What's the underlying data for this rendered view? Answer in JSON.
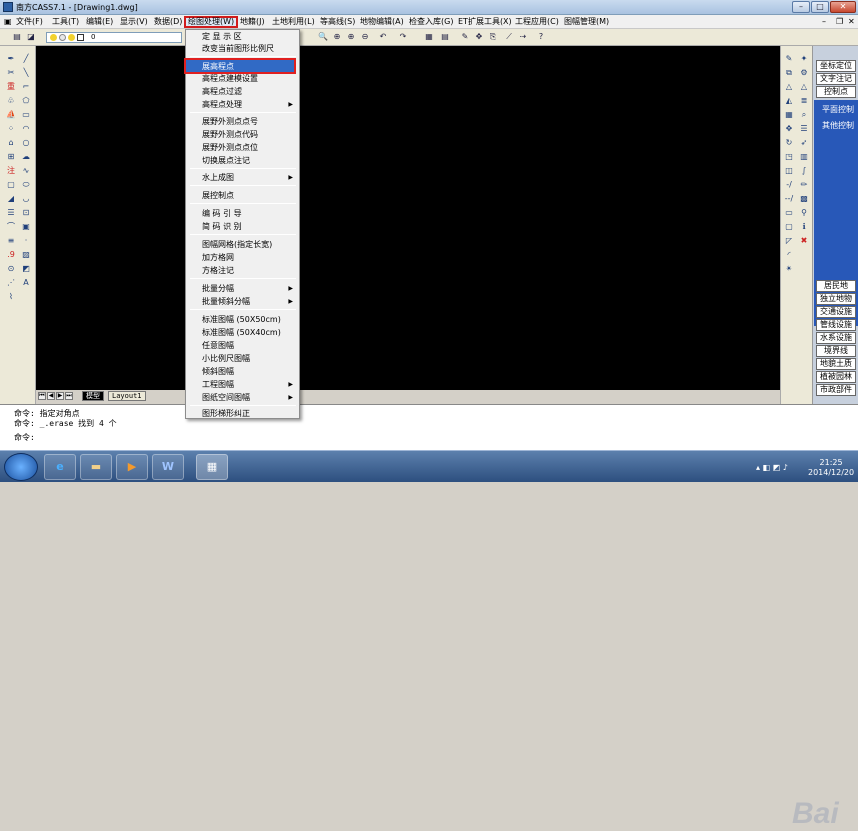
{
  "window": {
    "title": "南方CASS7.1 - [Drawing1.dwg]"
  },
  "menubar": [
    "文件(F)",
    "工具(T)",
    "编辑(E)",
    "显示(V)",
    "数据(D)",
    "绘图处理(W)",
    "地籍(J)",
    "土地利用(L)",
    "等高线(S)",
    "地物编辑(A)",
    "检查入库(G)",
    "ET扩展工具(X)",
    "工程应用(C)",
    "图幅管理(M)"
  ],
  "toolbar": {
    "layer_value": "0"
  },
  "dropdown": {
    "items": [
      "定 显 示 区",
      "改变当前图形比例尺",
      "展高程点",
      "高程点建模设置",
      "高程点过滤",
      "高程点处理",
      "展野外测点点号",
      "展野外测点代码",
      "展野外测点点位",
      "切换展点注记",
      "水上成图",
      "展控制点",
      "编 码 引 导",
      "简 码 识 别",
      "图幅网格(指定长宽)",
      "加方格网",
      "方格注记",
      "批量分幅",
      "批量倾斜分幅",
      "标准图幅 (50X50cm)",
      "标准图幅 (50X40cm)",
      "任意图幅",
      "小比例尺图幅",
      "倾斜图幅",
      "工程图幅",
      "图纸空间图幅",
      "图形梯形纠正"
    ],
    "submenu_indices": [
      5,
      10,
      17,
      18,
      24,
      25
    ],
    "selected": "展高程点"
  },
  "tabs": {
    "model": "模型",
    "layout": "Layout1"
  },
  "right_panel": {
    "top_buttons": [
      "坐标定位",
      "文字注记",
      "控制点"
    ],
    "blue_items": [
      "平面控制",
      "其他控制"
    ],
    "bottom_buttons": [
      "居民地",
      "独立地物",
      "交通设施",
      "管线设施",
      "水系设施",
      "境界线",
      "地貌土质",
      "植被园林",
      "市政部件"
    ]
  },
  "command": {
    "line1": "命令: 指定对角点",
    "line2": "命令: _.erase 找到 4 个",
    "prompt": "命令:",
    "input_value": ""
  },
  "watermark": "Bai",
  "taskbar": {
    "clock_time": "21:25",
    "clock_date": "2014/12/20"
  }
}
